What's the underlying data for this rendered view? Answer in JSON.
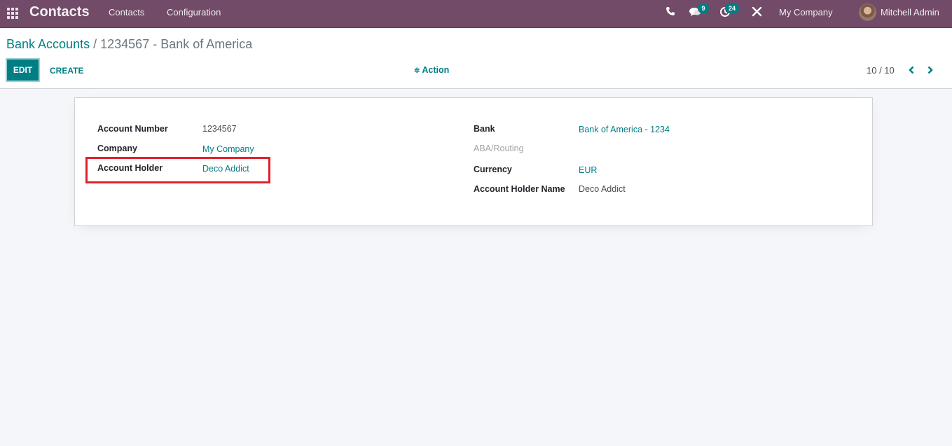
{
  "navbar": {
    "app_name": "Contacts",
    "menu": [
      {
        "label": "Contacts"
      },
      {
        "label": "Configuration"
      }
    ],
    "systray": {
      "phone_icon": "phone-icon",
      "messages_icon": "chat-bubbles-icon",
      "messages_count": "9",
      "activities_icon": "clock-icon",
      "activities_count": "24",
      "debug_icon": "tools-icon",
      "company": "My Company",
      "user": "Mitchell Admin"
    }
  },
  "control_panel": {
    "breadcrumb": {
      "parent": "Bank Accounts",
      "separator": "/",
      "current": "1234567 - Bank of America"
    },
    "buttons": {
      "edit": "EDIT",
      "create": "CREATE",
      "action": "Action"
    },
    "pager": {
      "value": "10 / 10"
    }
  },
  "form": {
    "left": [
      {
        "label": "Account Number",
        "value": "1234567",
        "link": false
      },
      {
        "label": "Company",
        "value": "My Company",
        "link": true
      },
      {
        "label": "Account Holder",
        "value": "Deco Addict",
        "link": true
      }
    ],
    "right": [
      {
        "label": "Bank",
        "value": "Bank of America - 1234",
        "link": true
      },
      {
        "label": "ABA/Routing",
        "value": "",
        "link": false
      },
      {
        "label": "Currency",
        "value": "EUR",
        "link": true
      },
      {
        "label": "Account Holder Name",
        "value": "Deco Addict",
        "link": false
      }
    ]
  },
  "colors": {
    "navbar": "#714b67",
    "primary": "#017e84",
    "highlight": "#e2202b"
  }
}
